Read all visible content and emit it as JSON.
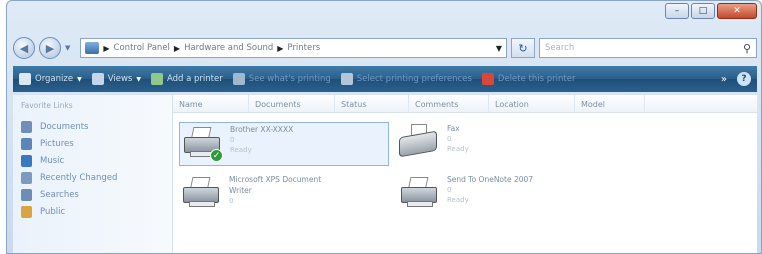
{
  "window": {
    "caption": {
      "minimize": "–",
      "maximize": "□",
      "close": "✕"
    }
  },
  "address": {
    "back_icon": "back-arrow-icon",
    "forward_icon": "forward-arrow-icon",
    "crumbs": [
      "Control Panel",
      "Hardware and Sound",
      "Printers"
    ],
    "search_placeholder": "Search"
  },
  "toolbar": {
    "items": [
      {
        "label": "Organize",
        "icon": "organize-icon",
        "dropdown": true
      },
      {
        "label": "Views",
        "icon": "views-icon",
        "dropdown": true
      },
      {
        "label": "Add a printer",
        "icon": "add-printer-icon"
      },
      {
        "label": "See what's printing",
        "icon": "queue-icon"
      },
      {
        "label": "Select printing preferences",
        "icon": "preferences-icon"
      },
      {
        "label": "Delete this printer",
        "icon": "delete-icon"
      }
    ],
    "overflow": "»",
    "help": "?"
  },
  "nav": {
    "heading": "Favorite Links",
    "items": [
      {
        "label": "Documents",
        "color": "#6f8fb8"
      },
      {
        "label": "Pictures",
        "color": "#5a87b5"
      },
      {
        "label": "Music",
        "color": "#3b78c2"
      },
      {
        "label": "Recently Changed",
        "color": "#7d9ac0"
      },
      {
        "label": "Searches",
        "color": "#6d8cb6"
      },
      {
        "label": "Public",
        "color": "#d9a441"
      }
    ]
  },
  "columns": [
    "Name",
    "Documents",
    "Status",
    "Comments",
    "Location",
    "Model"
  ],
  "printers": [
    {
      "name": "Brother XX-XXXX",
      "docs": "0",
      "status": "Ready",
      "default": true,
      "type": "printer"
    },
    {
      "name": "Fax",
      "docs": "0",
      "status": "Ready",
      "default": false,
      "type": "fax"
    },
    {
      "name": "Microsoft XPS Document",
      "name2": "Writer",
      "docs": "0",
      "status": "",
      "default": false,
      "type": "printer"
    },
    {
      "name": "Send To OneNote 2007",
      "docs": "0",
      "status": "Ready",
      "default": false,
      "type": "printer"
    }
  ]
}
